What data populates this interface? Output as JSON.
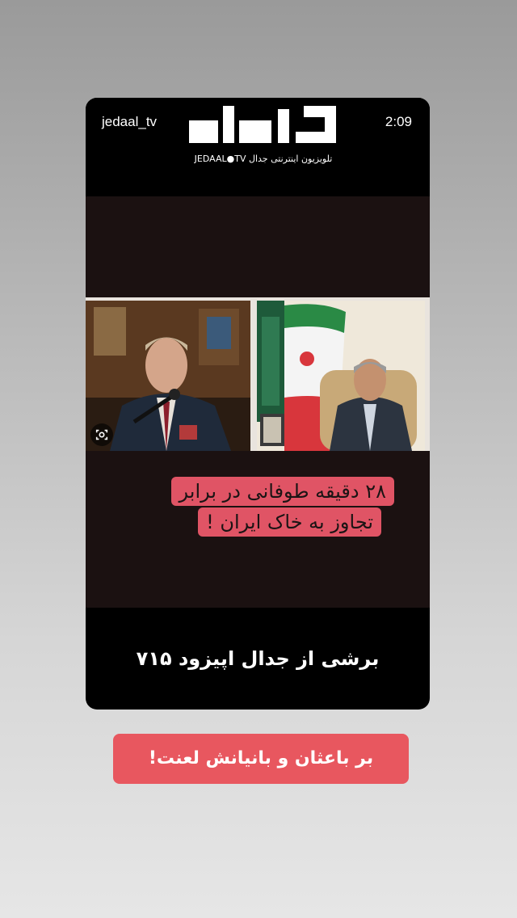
{
  "story": {
    "username": "jedaal_tv",
    "timestamp": "2:09"
  },
  "logo": {
    "wordmark": "جدال",
    "tagline": "تلویزیون اینترنتی جدال JEDAAL●TV"
  },
  "post": {
    "headline_line1": "۲۸ دقیقه طوفانی در برابر",
    "headline_line2": "تجاوز به خاک  ایران  !",
    "bottom_title": "برشی از جدال اپیزود ۷۱۵"
  },
  "caption": {
    "text": "بر باعثان و بانیانش لعنت!"
  },
  "colors": {
    "headline_bg": "#e05465",
    "caption_bg": "#e8575f",
    "card_bg": "#000000",
    "band_bg": "#1b1111"
  },
  "icons": {
    "visual_search": "camera-lens-icon"
  }
}
